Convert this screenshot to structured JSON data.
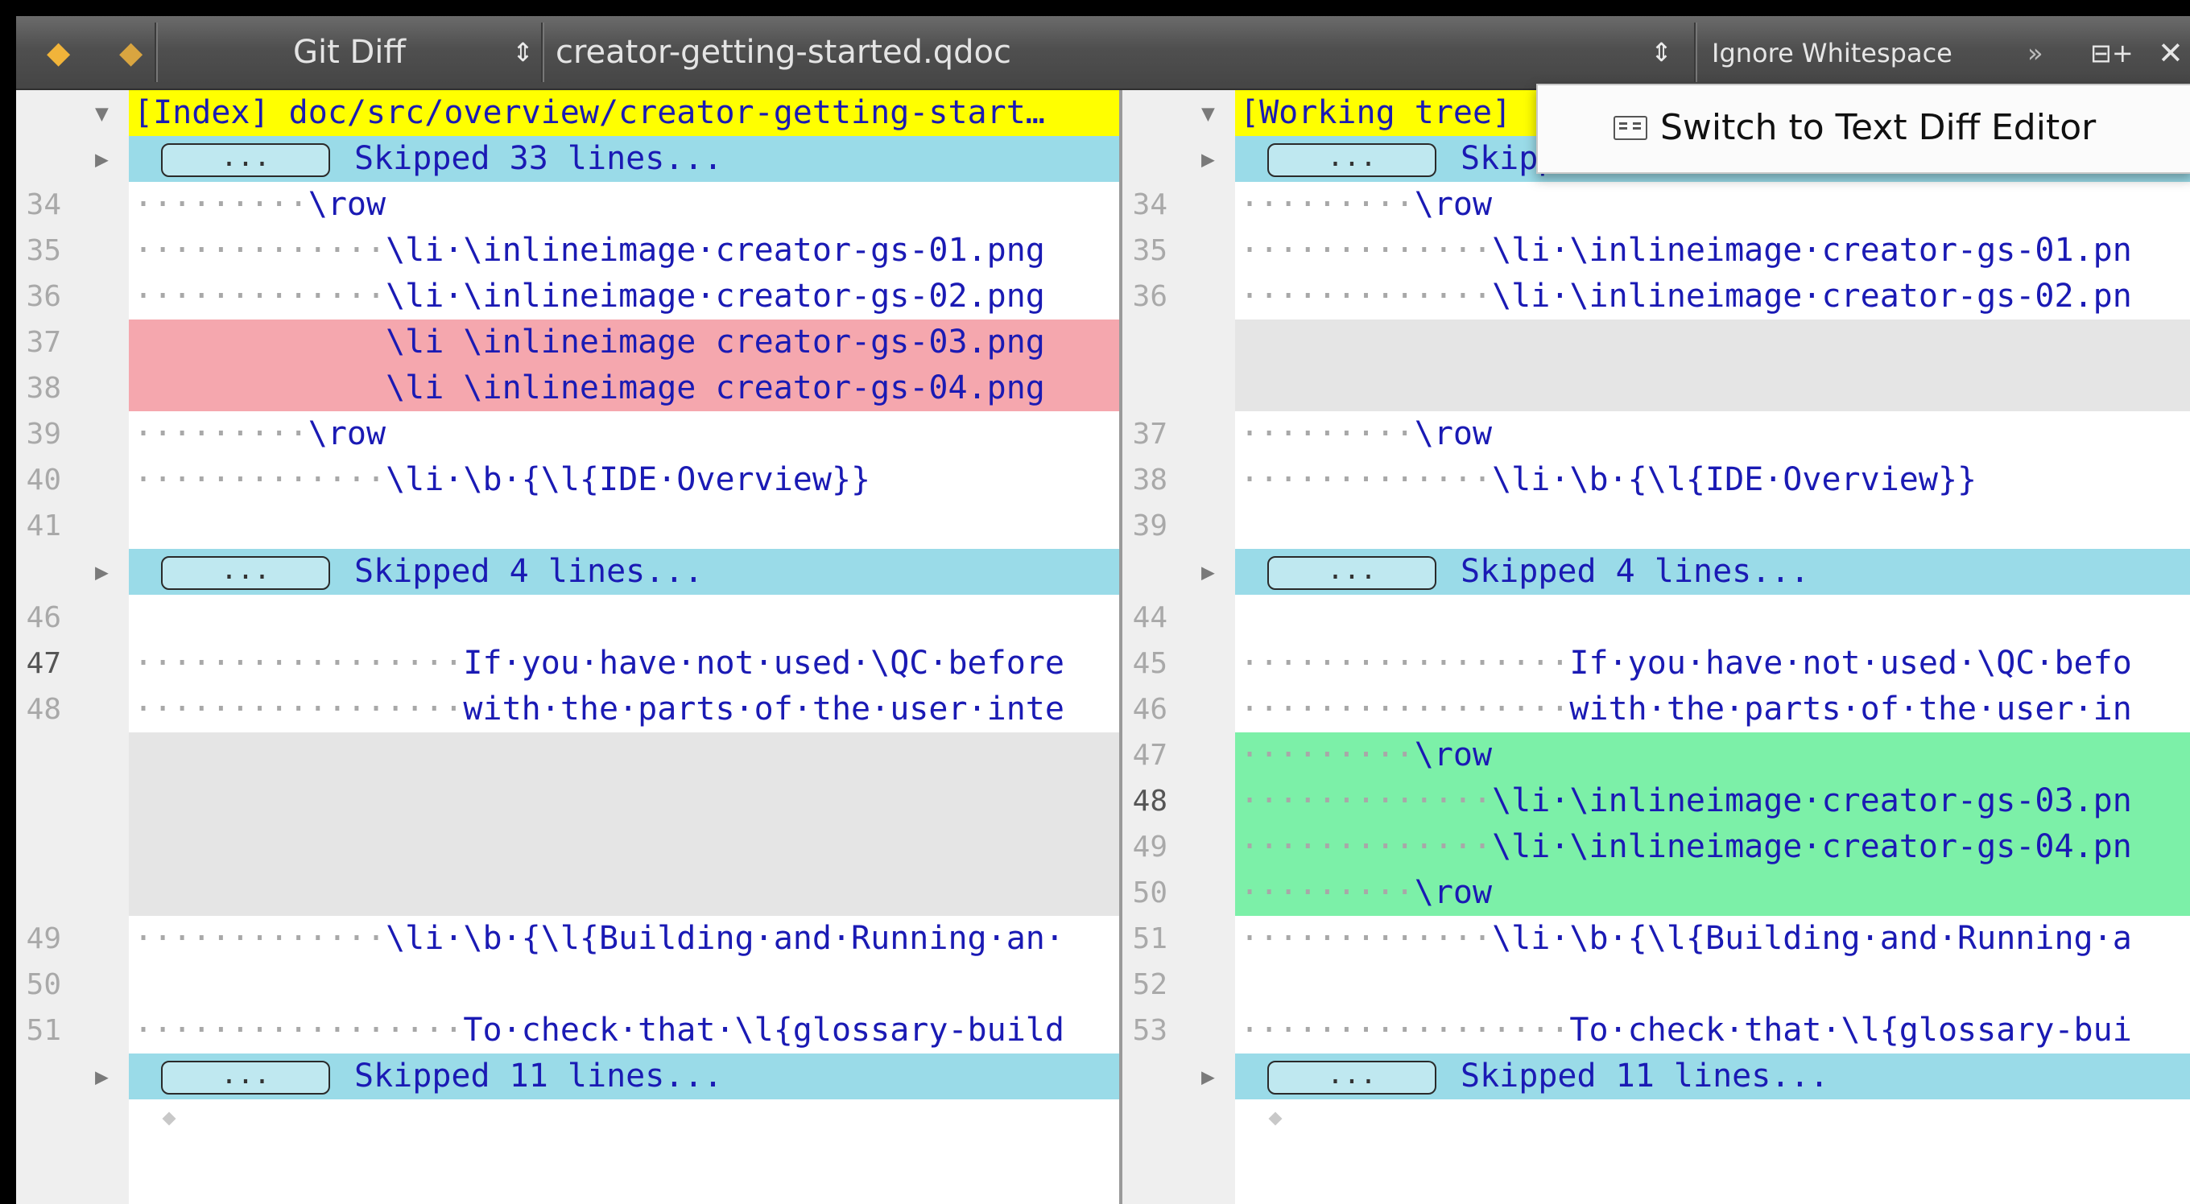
{
  "toolbar": {
    "back_icon": "arrow-left-icon",
    "forward_icon": "arrow-right-icon",
    "mode_label": "Git Diff",
    "file_label": "creator-getting-started.qdoc",
    "ignore_whitespace_label": "Ignore Whitespace",
    "overflow_icon": "double-chevron-right-icon",
    "split_icon": "split-add-icon",
    "close_icon": "close-icon",
    "updown_glyph": "⇕"
  },
  "popup": {
    "icon": "text-diff-icon",
    "label": "Switch to Text Diff Editor"
  },
  "skip_chip_label": "...",
  "left": {
    "rows": [
      {
        "type": "header",
        "fold": "▼",
        "text": "[Index] doc/src/overview/creator-getting-start…"
      },
      {
        "type": "skip",
        "fold": "▶",
        "text": "Skipped 33 lines..."
      },
      {
        "type": "normal",
        "ln": "34",
        "indent": "·········",
        "text": "\\row"
      },
      {
        "type": "normal",
        "ln": "35",
        "indent": "·············",
        "text": "\\li·\\inlineimage·creator-gs-01.png"
      },
      {
        "type": "normal",
        "ln": "36",
        "indent": "·············",
        "text": "\\li·\\inlineimage·creator-gs-02.png"
      },
      {
        "type": "del",
        "ln": "37",
        "indent": "             ",
        "text": "\\li \\inlineimage creator-gs-03.png"
      },
      {
        "type": "del",
        "ln": "38",
        "indent": "             ",
        "text": "\\li \\inlineimage creator-gs-04.png"
      },
      {
        "type": "normal",
        "ln": "39",
        "indent": "·········",
        "text": "\\row"
      },
      {
        "type": "normal",
        "ln": "40",
        "indent": "·············",
        "text": "\\li·\\b·{\\l{IDE·Overview}}"
      },
      {
        "type": "normal",
        "ln": "41",
        "indent": "",
        "text": ""
      },
      {
        "type": "skip",
        "fold": "▶",
        "text": "Skipped 4 lines..."
      },
      {
        "type": "normal",
        "ln": "46",
        "indent": "",
        "text": ""
      },
      {
        "type": "normal",
        "ln": "47",
        "cur": true,
        "indent": "·················",
        "text": "If·you·have·not·used·\\QC·before"
      },
      {
        "type": "normal",
        "ln": "48",
        "indent": "·················",
        "text": "with·the·parts·of·the·user·inte"
      },
      {
        "type": "gap",
        "ln": "",
        "indent": "",
        "text": ""
      },
      {
        "type": "gap",
        "ln": "",
        "indent": "",
        "text": ""
      },
      {
        "type": "gap",
        "ln": "",
        "indent": "",
        "text": ""
      },
      {
        "type": "gap",
        "ln": "",
        "indent": "",
        "text": ""
      },
      {
        "type": "normal",
        "ln": "49",
        "indent": "·············",
        "text": "\\li·\\b·{\\l{Building·and·Running·an·"
      },
      {
        "type": "normal",
        "ln": "50",
        "indent": "",
        "text": ""
      },
      {
        "type": "normal",
        "ln": "51",
        "indent": "·················",
        "text": "To·check·that·\\l{glossary-build"
      },
      {
        "type": "skip",
        "fold": "▶",
        "text": "Skipped 11 lines..."
      },
      {
        "type": "end",
        "ln": "",
        "indent": "",
        "text": ""
      }
    ]
  },
  "right": {
    "rows": [
      {
        "type": "header",
        "fold": "▼",
        "text": "[Working tree]"
      },
      {
        "type": "skip",
        "fold": "▶",
        "text": "Skipped 33 lines..."
      },
      {
        "type": "normal",
        "ln": "34",
        "indent": "·········",
        "text": "\\row"
      },
      {
        "type": "normal",
        "ln": "35",
        "indent": "·············",
        "text": "\\li·\\inlineimage·creator-gs-01.pn"
      },
      {
        "type": "normal",
        "ln": "36",
        "indent": "·············",
        "text": "\\li·\\inlineimage·creator-gs-02.pn"
      },
      {
        "type": "gap",
        "ln": "",
        "indent": "",
        "text": ""
      },
      {
        "type": "gap",
        "ln": "",
        "indent": "",
        "text": ""
      },
      {
        "type": "normal",
        "ln": "37",
        "indent": "·········",
        "text": "\\row"
      },
      {
        "type": "normal",
        "ln": "38",
        "indent": "·············",
        "text": "\\li·\\b·{\\l{IDE·Overview}}"
      },
      {
        "type": "normal",
        "ln": "39",
        "indent": "",
        "text": ""
      },
      {
        "type": "skip",
        "fold": "▶",
        "text": "Skipped 4 lines..."
      },
      {
        "type": "normal",
        "ln": "44",
        "indent": "",
        "text": ""
      },
      {
        "type": "normal",
        "ln": "45",
        "indent": "·················",
        "text": "If·you·have·not·used·\\QC·befo"
      },
      {
        "type": "normal",
        "ln": "46",
        "indent": "·················",
        "text": "with·the·parts·of·the·user·in"
      },
      {
        "type": "add",
        "ln": "47",
        "indent": "·········",
        "text": "\\row"
      },
      {
        "type": "add",
        "ln": "48",
        "cur": true,
        "indent": "·············",
        "text": "\\li·\\inlineimage·creator-gs-03.pn"
      },
      {
        "type": "add",
        "ln": "49",
        "indent": "·············",
        "text": "\\li·\\inlineimage·creator-gs-04.pn"
      },
      {
        "type": "add",
        "ln": "50",
        "indent": "·········",
        "text": "\\row"
      },
      {
        "type": "normal",
        "ln": "51",
        "indent": "·············",
        "text": "\\li·\\b·{\\l{Building·and·Running·a"
      },
      {
        "type": "normal",
        "ln": "52",
        "indent": "",
        "text": ""
      },
      {
        "type": "normal",
        "ln": "53",
        "indent": "·················",
        "text": "To·check·that·\\l{glossary-bui"
      },
      {
        "type": "skip",
        "fold": "▶",
        "text": "Skipped 11 lines..."
      },
      {
        "type": "end",
        "ln": "",
        "indent": "",
        "text": ""
      }
    ]
  }
}
